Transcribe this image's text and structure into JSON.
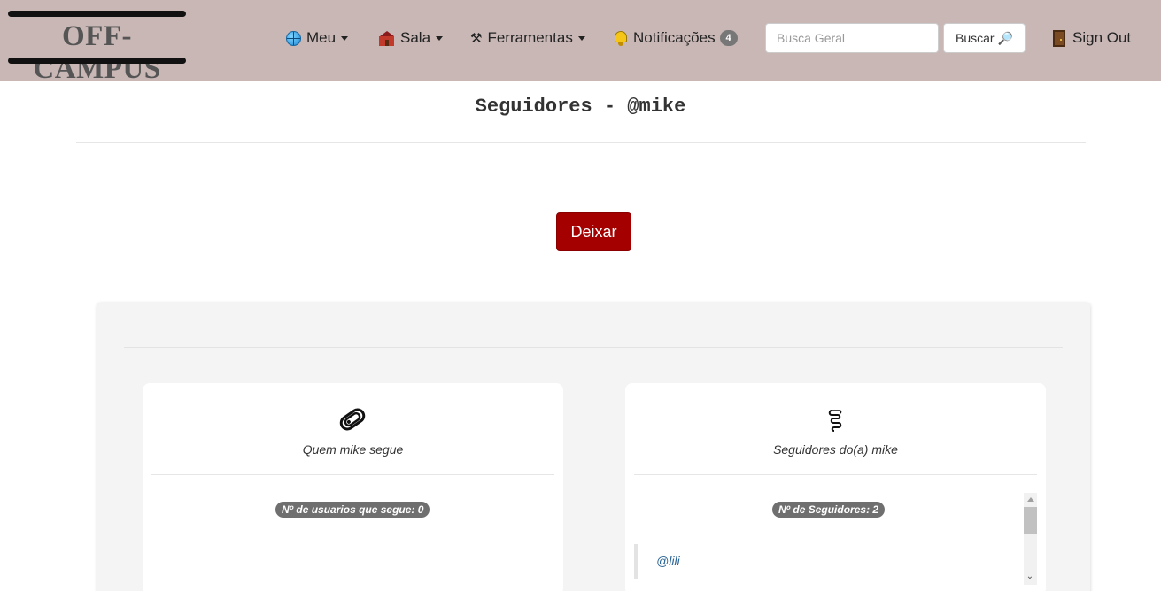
{
  "navbar": {
    "logo_text": "OFF-CAMPUS",
    "menu": [
      {
        "label": "Meu",
        "icon": "globe-icon",
        "has_caret": true
      },
      {
        "label": "Sala",
        "icon": "school-icon",
        "has_caret": true
      },
      {
        "label": "Ferramentas",
        "icon": "tools-icon",
        "has_caret": true
      },
      {
        "label": "Notificações",
        "icon": "bell-icon",
        "badge": "4"
      }
    ],
    "search": {
      "placeholder": "Busca Geral",
      "value": "",
      "button_label": "Buscar",
      "button_icon": "magnifier-icon"
    },
    "signout": {
      "label": "Sign Out",
      "icon": "door-icon"
    },
    "background_color": "#c8b7b5"
  },
  "page": {
    "title": "Seguidores - @mike",
    "leave_button": "Deixar",
    "leave_button_color": "#a50000"
  },
  "following_panel": {
    "icon": "paperclip-icon",
    "caption": "Quem mike segue",
    "count_label": "Nº de usuarios que segue: 0",
    "entries": []
  },
  "followers_panel": {
    "icon": "scroll-icon",
    "caption": "Seguidores do(a) mike",
    "count_label": "Nº de Seguidores: 2",
    "entries": [
      {
        "handle": "@lili"
      }
    ]
  }
}
